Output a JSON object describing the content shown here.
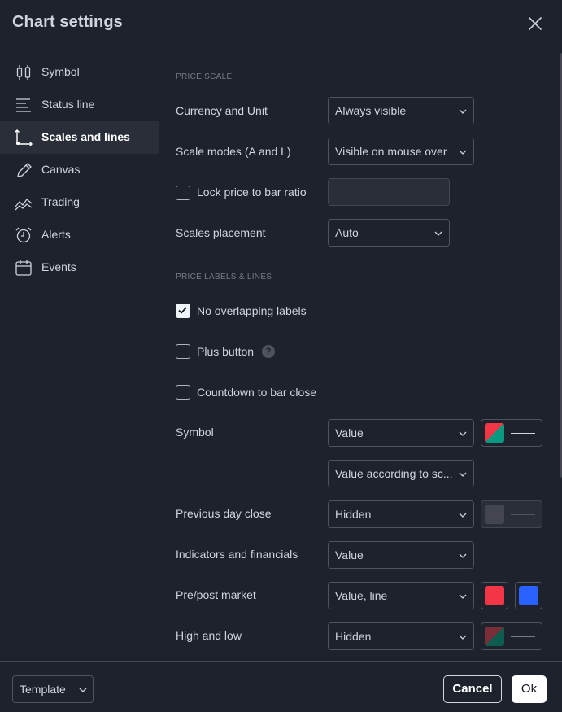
{
  "header": {
    "title": "Chart settings",
    "close_icon": "close-icon"
  },
  "sidebar": {
    "items": [
      {
        "label": "Symbol",
        "icon": "candlestick-icon",
        "active": false
      },
      {
        "label": "Status line",
        "icon": "status-line-icon",
        "active": false
      },
      {
        "label": "Scales and lines",
        "icon": "scales-icon",
        "active": true
      },
      {
        "label": "Canvas",
        "icon": "pencil-icon",
        "active": false
      },
      {
        "label": "Trading",
        "icon": "trading-icon",
        "active": false
      },
      {
        "label": "Alerts",
        "icon": "alarm-clock-icon",
        "active": false
      },
      {
        "label": "Events",
        "icon": "calendar-icon",
        "active": false
      }
    ]
  },
  "price_scale": {
    "section_title": "PRICE SCALE",
    "currency_unit": {
      "label": "Currency and Unit",
      "value": "Always visible"
    },
    "scale_modes": {
      "label": "Scale modes (A and L)",
      "value": "Visible on mouse over"
    },
    "lock_ratio": {
      "label": "Lock price to bar ratio",
      "checked": false,
      "value": ""
    },
    "scales_placement": {
      "label": "Scales placement",
      "value": "Auto"
    }
  },
  "price_labels": {
    "section_title": "PRICE LABELS & LINES",
    "no_overlapping": {
      "label": "No overlapping labels",
      "checked": true
    },
    "plus_button": {
      "label": "Plus button",
      "checked": false,
      "help": "?"
    },
    "countdown": {
      "label": "Countdown to bar close",
      "checked": false
    },
    "symbol": {
      "label": "Symbol",
      "value": "Value",
      "value2": "Value according to sc...",
      "colors": [
        "#f23645",
        "#089981"
      ]
    },
    "prev_day_close": {
      "label": "Previous day close",
      "value": "Hidden",
      "color": "#434651"
    },
    "indicators": {
      "label": "Indicators and financials",
      "value": "Value"
    },
    "pre_post": {
      "label": "Pre/post market",
      "value": "Value, line",
      "colors": [
        "#f23645",
        "#2962ff"
      ]
    },
    "high_low": {
      "label": "High and low",
      "value": "Hidden",
      "colors": [
        "#7a2e38",
        "#0d5c4f"
      ]
    }
  },
  "footer": {
    "template_label": "Template",
    "cancel_label": "Cancel",
    "ok_label": "Ok"
  },
  "colors": {
    "background": "#1e222d",
    "border": "#434651",
    "text": "#d1d4dc",
    "muted": "#787b86"
  }
}
